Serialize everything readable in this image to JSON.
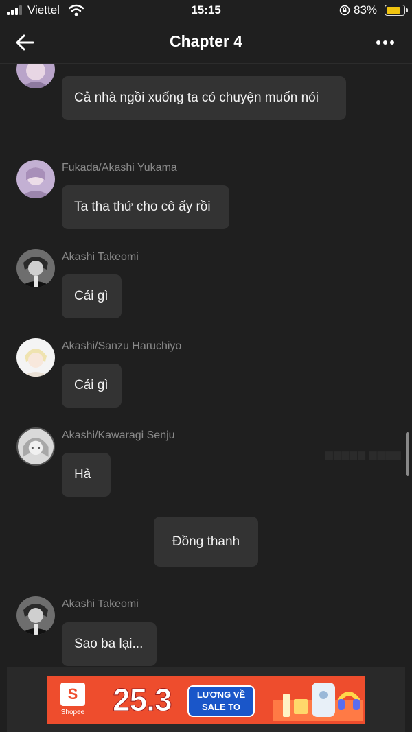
{
  "status_bar": {
    "carrier": "Viettel",
    "time": "15:15",
    "battery": "83%"
  },
  "header": {
    "title": "Chapter 4"
  },
  "messages": [
    {
      "sender": "",
      "text": "Cả nhà ngồi xuống ta có chuyện muốn nói"
    },
    {
      "sender": "Fukada/Akashi Yukama",
      "text": "Ta tha thứ cho cô ấy rồi"
    },
    {
      "sender": "Akashi Takeomi",
      "text": "Cái gì"
    },
    {
      "sender": "Akashi/Sanzu Haruchiyo",
      "text": "Cái gì"
    },
    {
      "sender": "Akashi/Kawaragi Senju",
      "text": "Hả"
    },
    {
      "sender": "",
      "text": "Đồng thanh"
    },
    {
      "sender": "Akashi Takeomi",
      "text": "Sao ba lại..."
    }
  ],
  "ad": {
    "brand": "Shopee",
    "brand_letter": "S",
    "headline": "25.3",
    "badge_line1": "LƯƠNG VỀ",
    "badge_line2": "SALE TO"
  },
  "colors": {
    "background": "#1f1f1f",
    "bubble": "#333333",
    "sender_name": "#8a8a8a",
    "battery": "#f1c40f",
    "ad_brand": "#ee4d2d"
  },
  "icons": [
    "back-arrow-icon",
    "more-icon",
    "signal-icon",
    "wifi-icon",
    "orientation-lock-icon",
    "battery-icon"
  ]
}
